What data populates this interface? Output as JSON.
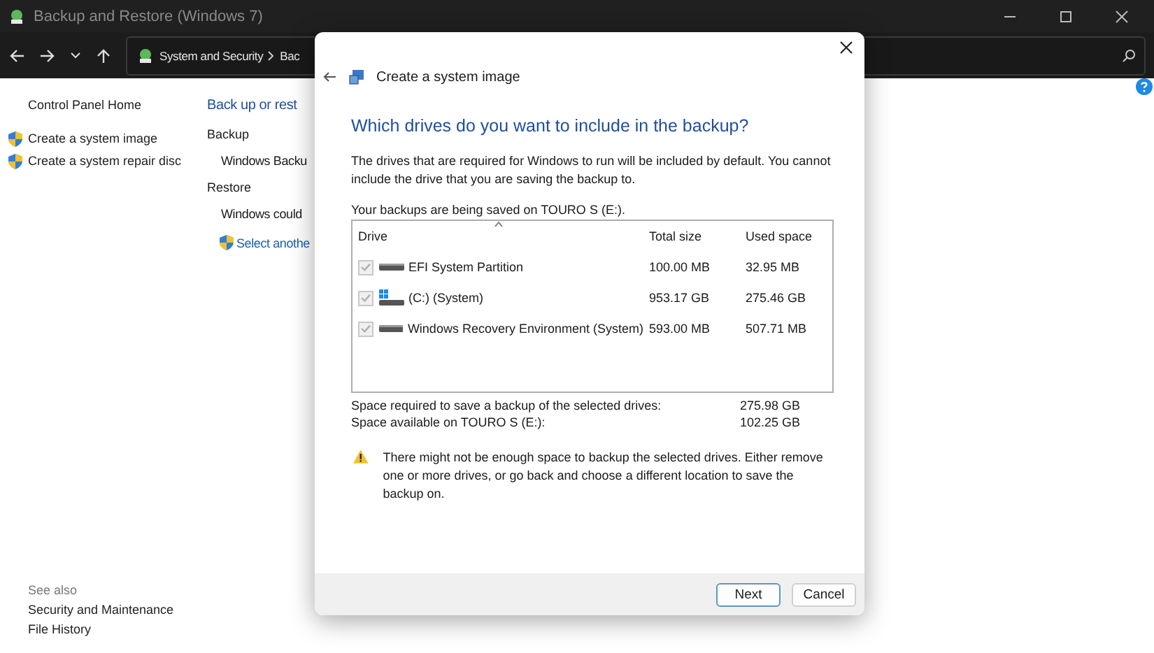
{
  "window": {
    "title": "Backup and Restore (Windows 7)"
  },
  "address_bar": {
    "segments": [
      "System and Security",
      "Bac"
    ]
  },
  "left_pane": {
    "links": [
      {
        "label": "Control Panel Home",
        "kind": "plain"
      },
      {
        "label": "Create a system image",
        "kind": "shield"
      },
      {
        "label": "Create a system repair disc",
        "kind": "shield"
      }
    ],
    "see_also": {
      "title": "See also",
      "links": [
        "Security and Maintenance",
        "File History"
      ]
    }
  },
  "main": {
    "heading": "Back up or rest",
    "sections": [
      {
        "title": "Backup",
        "items": [
          {
            "text": "Windows Backu",
            "kind": "text"
          }
        ]
      },
      {
        "title": "Restore",
        "items": [
          {
            "text": "Windows could",
            "kind": "text"
          },
          {
            "text": "Select anothe",
            "kind": "shield-link"
          }
        ]
      }
    ]
  },
  "dialog": {
    "title": "Create a system image",
    "heading": "Which drives do you want to include in the backup?",
    "description": "The drives that are required for Windows to run will be included by default. You cannot include the drive that you are saving the backup to.",
    "save_location": "Your backups are being saved on TOURO S (E:).",
    "table": {
      "columns": [
        "Drive",
        "Total size",
        "Used space"
      ],
      "rows": [
        {
          "drive": "EFI System Partition",
          "total_size": "100.00 MB",
          "used_space": "32.95 MB",
          "checked": true,
          "disabled": true,
          "kind": "drive"
        },
        {
          "drive": "(C:) (System)",
          "total_size": "953.17 GB",
          "used_space": "275.46 GB",
          "checked": true,
          "disabled": true,
          "kind": "windows"
        },
        {
          "drive": "Windows Recovery Environment (System)",
          "total_size": "593.00 MB",
          "used_space": "507.71 MB",
          "checked": true,
          "disabled": true,
          "kind": "drive"
        }
      ]
    },
    "summary": [
      {
        "label": "Space required to save a backup of the selected drives:",
        "value": "275.98 GB"
      },
      {
        "label": "Space available on TOURO S (E:):",
        "value": "102.25 GB"
      }
    ],
    "warning": "There might not be enough space to backup the selected drives. Either remove one or more drives, or go back and choose a different location to save the backup on.",
    "buttons": [
      {
        "label": "Next",
        "kind": "primary"
      },
      {
        "label": "Cancel",
        "kind": "secondary"
      }
    ]
  }
}
